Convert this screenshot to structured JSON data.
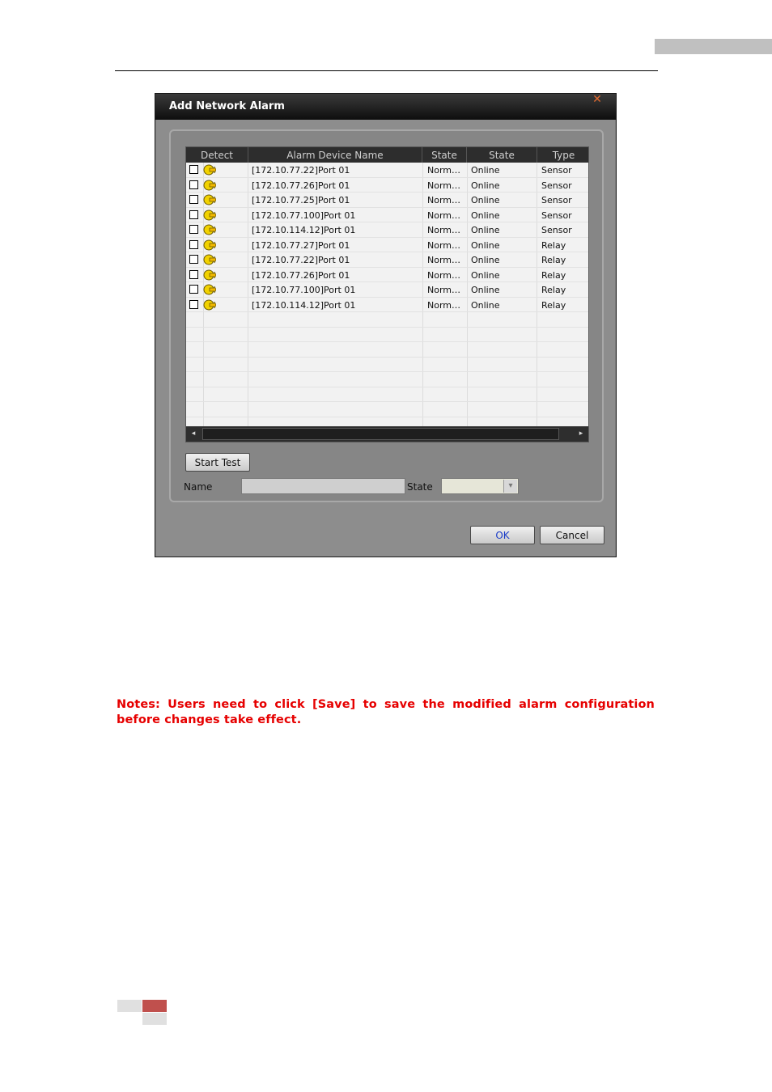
{
  "dialog": {
    "title": "Add Network Alarm",
    "close_glyph": "✕"
  },
  "table": {
    "columns": [
      "Detect",
      "Alarm Device Name",
      "State",
      "State",
      "Type"
    ],
    "rows": [
      {
        "name": "[172.10.77.22]Port 01",
        "state1": "Norm…",
        "state2": "Online",
        "type": "Sensor"
      },
      {
        "name": "[172.10.77.26]Port 01",
        "state1": "Norm…",
        "state2": "Online",
        "type": "Sensor"
      },
      {
        "name": "[172.10.77.25]Port 01",
        "state1": "Norm…",
        "state2": "Online",
        "type": "Sensor"
      },
      {
        "name": "[172.10.77.100]Port 01",
        "state1": "Norm…",
        "state2": "Online",
        "type": "Sensor"
      },
      {
        "name": "[172.10.114.12]Port 01",
        "state1": "Norm…",
        "state2": "Online",
        "type": "Sensor"
      },
      {
        "name": "[172.10.77.27]Port 01",
        "state1": "Norm…",
        "state2": "Online",
        "type": "Relay"
      },
      {
        "name": "[172.10.77.22]Port 01",
        "state1": "Norm…",
        "state2": "Online",
        "type": "Relay"
      },
      {
        "name": "[172.10.77.26]Port 01",
        "state1": "Norm…",
        "state2": "Online",
        "type": "Relay"
      },
      {
        "name": "[172.10.77.100]Port 01",
        "state1": "Norm…",
        "state2": "Online",
        "type": "Relay"
      },
      {
        "name": "[172.10.114.12]Port 01",
        "state1": "Norm…",
        "state2": "Online",
        "type": "Relay"
      }
    ],
    "scroll_left": "◂",
    "scroll_right": "▸"
  },
  "controls": {
    "start_test": "Start Test",
    "name_label": "Name",
    "state_label": "State",
    "dropdown_glyph": "▾"
  },
  "footer": {
    "ok": "OK",
    "cancel": "Cancel"
  },
  "notes": "Notes: Users need to click [Save] to save the modified alarm configuration before changes take effect.",
  "colors": {
    "notes": "#e60000",
    "accent_red": "#c0504d",
    "ok_text": "#1a3cc8"
  }
}
